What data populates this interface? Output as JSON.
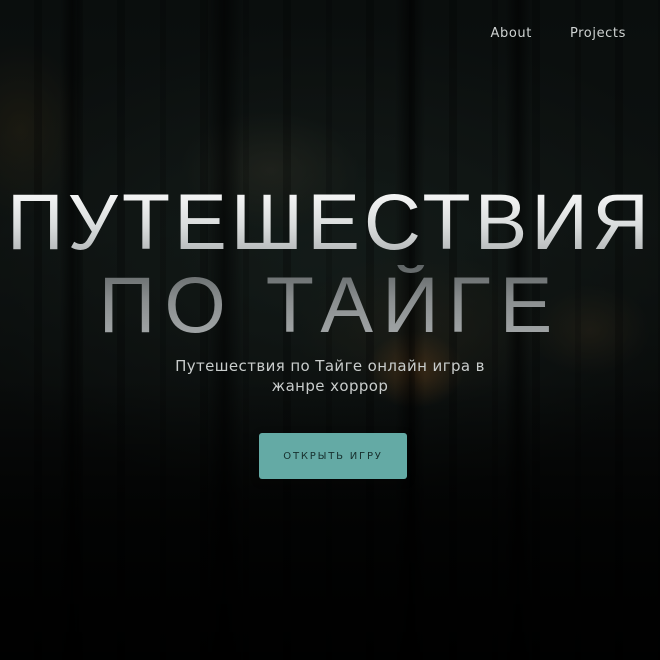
{
  "nav": {
    "items": [
      {
        "label": "About"
      },
      {
        "label": "Projects"
      }
    ]
  },
  "hero": {
    "title_line1": "Путешествия",
    "title_line2": "по Тайге",
    "subtitle": "Путешествия по Тайге онлайн игра в жанре хоррор",
    "cta_label": "Открыть игру"
  },
  "colors": {
    "accent": "#64aaa5",
    "background": "#0a0c0b"
  }
}
